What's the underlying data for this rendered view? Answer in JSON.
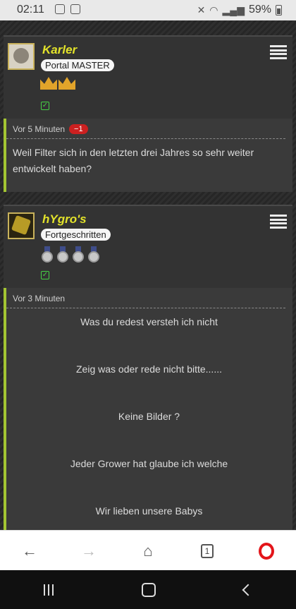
{
  "status_bar": {
    "time": "02:11",
    "battery": "59%"
  },
  "posts": [
    {
      "username": "Karler",
      "rank": "Portal MASTER",
      "timestamp": "Vor 5 Minuten",
      "vote": "−1",
      "text": "Weil Filter sich in den letzten drei Jahres so sehr weiter entwickelt haben?"
    },
    {
      "username": "hYgro's",
      "rank": "Fortgeschritten",
      "timestamp": "Vor 3 Minuten",
      "lines": [
        "Was du redest versteh ich nicht",
        "Zeig was oder rede nicht bitte......",
        "Keine Bilder ?",
        "Jeder Grower hat glaube ich welche",
        "Wir lieben unsere Babys"
      ]
    }
  ],
  "toolbar": {
    "tab_count": "1"
  },
  "icons": {
    "back": "back-arrow-icon",
    "forward": "forward-arrow-icon",
    "home": "home-icon",
    "tabs": "tabs-icon",
    "opera": "opera-logo-icon"
  }
}
